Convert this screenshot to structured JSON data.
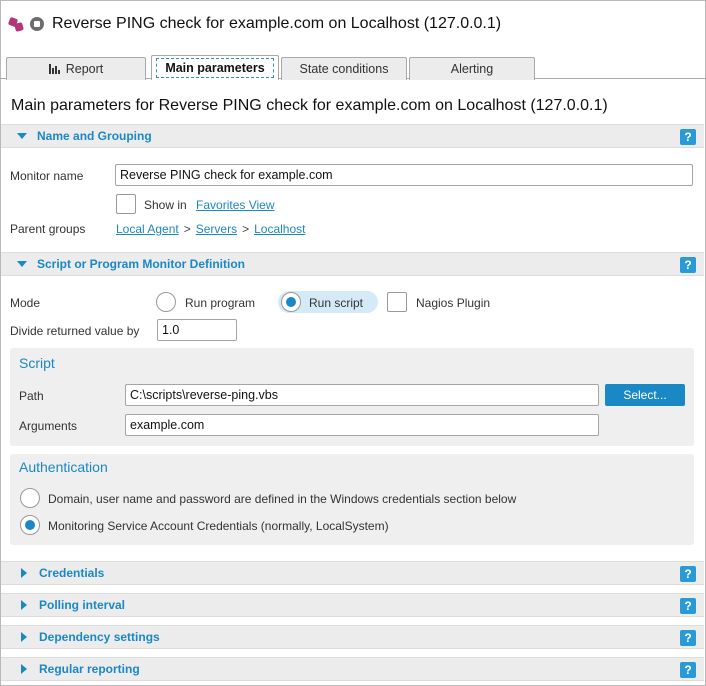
{
  "window": {
    "title": "Reverse PING check for example.com on Localhost (127.0.0.1)"
  },
  "tabs": [
    {
      "label": "Report",
      "icon": "bar-chart-icon"
    },
    {
      "label": "Main parameters"
    },
    {
      "label": "State conditions"
    },
    {
      "label": "Alerting"
    }
  ],
  "heading": "Main parameters for Reverse PING check for example.com on Localhost (127.0.0.1)",
  "help_label": "?",
  "name_grouping": {
    "title": "Name and Grouping",
    "monitor_name_label": "Monitor name",
    "monitor_name_value": "Reverse PING check for example.com",
    "show_in_label": "Show in",
    "show_in_link": "Favorites View",
    "parent_groups_label": "Parent groups",
    "sep": ">",
    "groups": [
      "Local Agent",
      "Servers",
      "Localhost"
    ]
  },
  "definition": {
    "title": "Script or Program Monitor Definition",
    "mode_label": "Mode",
    "modes": [
      "Run program",
      "Run script",
      "Nagios Plugin"
    ],
    "selected_mode": "Run script",
    "divide_label": "Divide returned value by",
    "divide_value": "1.0",
    "script": {
      "title": "Script",
      "path_label": "Path",
      "path_value": "C:\\scripts\\reverse-ping.vbs",
      "select_label": "Select...",
      "arguments_label": "Arguments",
      "arguments_value": "example.com"
    },
    "authentication": {
      "title": "Authentication",
      "options": [
        "Domain, user name and password are defined in the Windows credentials section below",
        "Monitoring Service Account Credentials (normally, LocalSystem)"
      ],
      "selected_index": 1
    }
  },
  "collapsed_sections": [
    "Credentials",
    "Polling interval",
    "Dependency settings",
    "Regular reporting"
  ],
  "colors": {
    "accent": "#1a88c4",
    "header_bg": "#ececec",
    "panel_bg": "#efefef",
    "brand": "#b3367a"
  }
}
